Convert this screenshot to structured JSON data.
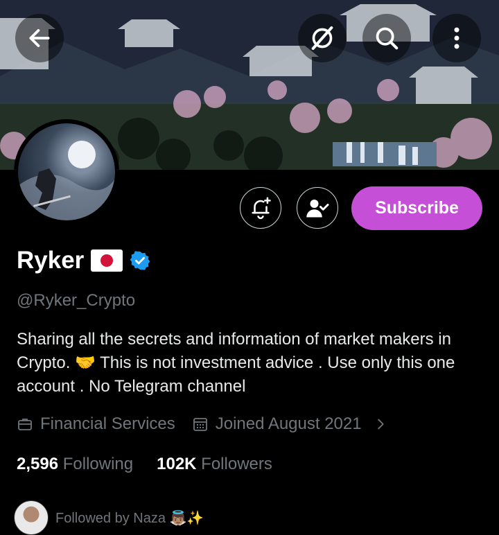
{
  "header": {
    "back_icon": "arrow-left-icon",
    "grok_icon": "grok-icon",
    "search_icon": "search-icon",
    "more_icon": "more-vertical-icon"
  },
  "actions": {
    "notify_icon": "bell-plus-icon",
    "following_icon": "person-check-icon",
    "subscribe_label": "Subscribe",
    "subscribe_color": "#c54fd6"
  },
  "profile": {
    "name": "Ryker",
    "flag": "🇯🇵",
    "verified": true,
    "handle": "@Ryker_Crypto",
    "bio": "Sharing all the secrets and information of market makers in Crypto. 🤝 This is not investment advice . Use only this one account . No Telegram channel",
    "category": "Financial Services",
    "joined": "Joined August 2021",
    "following_count": "2,596",
    "following_label": "Following",
    "followers_count": "102K",
    "followers_label": "Followers",
    "followed_by": "Followed by Naza 👼🏽✨"
  },
  "colors": {
    "background": "#000000",
    "verified_badge": "#1d9bf0",
    "muted_text": "#71767b"
  }
}
